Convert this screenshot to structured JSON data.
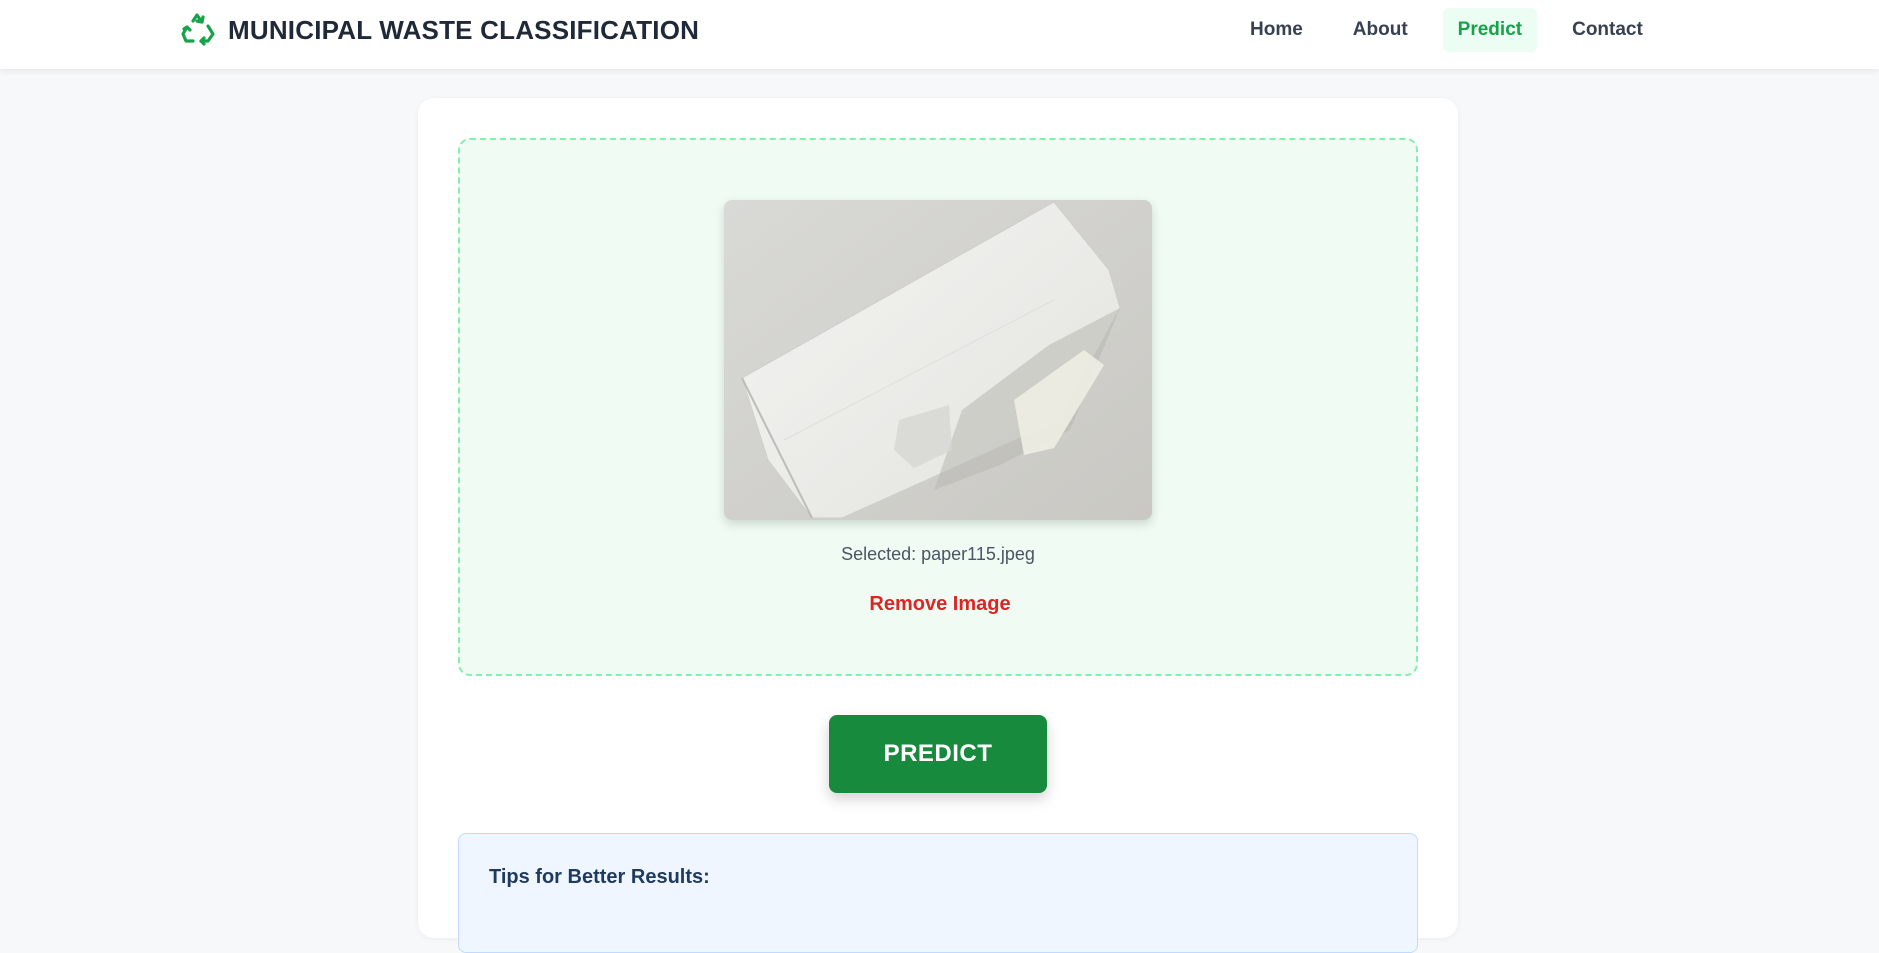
{
  "header": {
    "title": "MUNICIPAL WASTE CLASSIFICATION",
    "logo_icon": "recycle-icon",
    "accent_color": "#16a34a"
  },
  "nav": {
    "items": [
      {
        "label": "Home",
        "active": false
      },
      {
        "label": "About",
        "active": false
      },
      {
        "label": "Predict",
        "active": true
      },
      {
        "label": "Contact",
        "active": false
      }
    ]
  },
  "upload": {
    "selected_label": "Selected: paper115.jpeg",
    "remove_label": "Remove Image"
  },
  "actions": {
    "predict_label": "PREDICT",
    "predict_color": "#178a3e"
  },
  "tips": {
    "title": "Tips for Better Results:"
  }
}
